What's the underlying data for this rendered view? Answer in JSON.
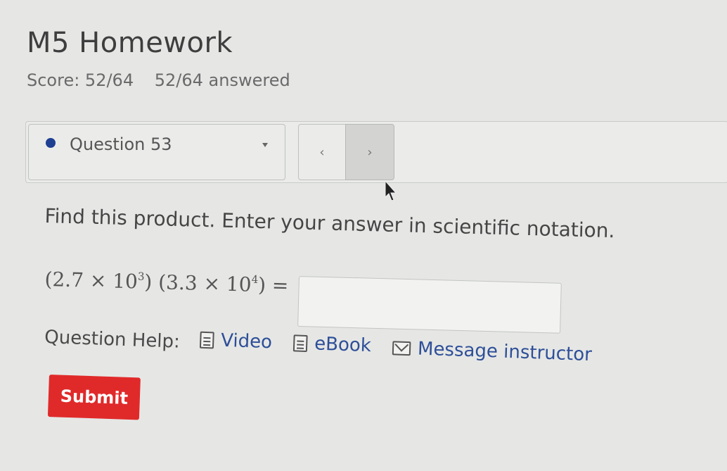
{
  "header": {
    "title": "M5 Homework",
    "score": "Score: 52/64",
    "answered": "52/64 answered"
  },
  "question_nav": {
    "selected": "Question 53",
    "status_color": "#1f3f92",
    "prev_label": "‹",
    "next_label": "›"
  },
  "question": {
    "prompt": "Find this product. Enter your answer in scientific notation.",
    "expression": {
      "open1": "(2.7 × 10",
      "exp1": "3",
      "close1": ")",
      "open2": "(3.3 × 10",
      "exp2": "4",
      "close2": ")",
      "equals": "="
    },
    "answer_value": ""
  },
  "help": {
    "label": "Question Help:",
    "video": "Video",
    "ebook": "eBook",
    "message": "Message instructor"
  },
  "submit_label": "Submit",
  "colors": {
    "link": "#2e4f98",
    "submit": "#e02a2a"
  }
}
